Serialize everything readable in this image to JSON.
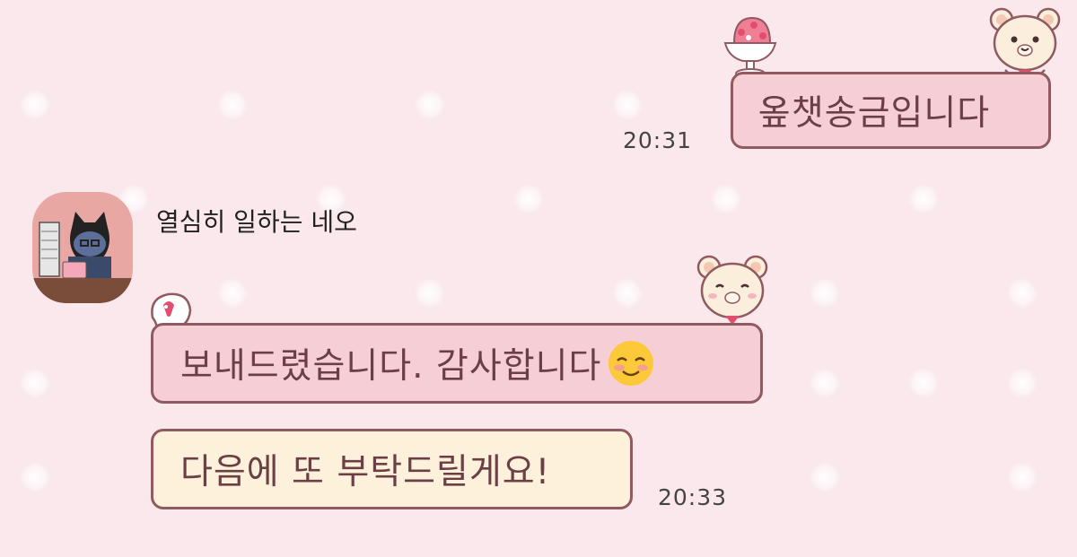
{
  "chat": {
    "messages": [
      {
        "direction": "outgoing",
        "text": "옾챗송금입니다",
        "time": "20:31"
      },
      {
        "direction": "incoming",
        "sender": "열심히 일하는 네오",
        "text": "보내드렸습니다. 감사합니다",
        "emoji": "smiling-blush-emoji"
      },
      {
        "direction": "incoming",
        "text": "다음에 또 부탁드릴게요!",
        "time": "20:33"
      }
    ]
  },
  "theme": {
    "background": "#fae8ec",
    "bubble_pink": "#f6cfd6",
    "bubble_cream": "#fdf1dc",
    "bubble_border": "#8f5a60",
    "text_color": "#6b3f45"
  }
}
